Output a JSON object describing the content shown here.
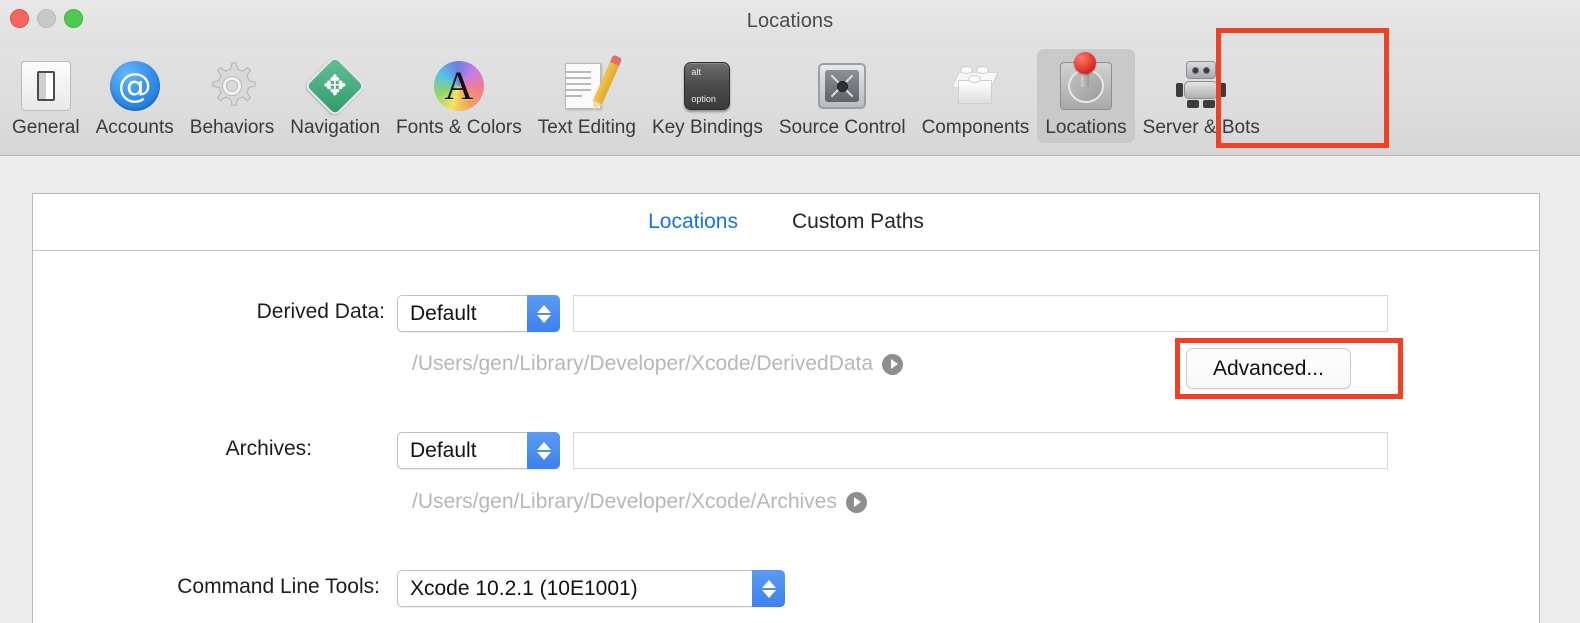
{
  "window": {
    "title": "Locations",
    "traffic_lights": [
      "close-button",
      "minimize-button",
      "zoom-button"
    ]
  },
  "toolbar": {
    "items": [
      {
        "label": "General",
        "icon": "light-switch-icon",
        "selected": false
      },
      {
        "label": "Accounts",
        "icon": "at-sign-icon",
        "selected": false
      },
      {
        "label": "Behaviors",
        "icon": "gear-icon",
        "selected": false
      },
      {
        "label": "Navigation",
        "icon": "four-way-arrow-icon",
        "selected": false
      },
      {
        "label": "Fonts & Colors",
        "icon": "colored-letter-a-icon",
        "selected": false
      },
      {
        "label": "Text Editing",
        "icon": "document-pencil-icon",
        "selected": false
      },
      {
        "label": "Key Bindings",
        "icon": "keyboard-key-icon",
        "selected": false,
        "keycap_top": "alt",
        "keycap_bottom": "option"
      },
      {
        "label": "Source Control",
        "icon": "safe-vault-icon",
        "selected": false
      },
      {
        "label": "Components",
        "icon": "brick-icon",
        "selected": false
      },
      {
        "label": "Locations",
        "icon": "hard-drive-pin-icon",
        "selected": true
      },
      {
        "label": "Server & Bots",
        "icon": "robot-icon",
        "selected": false
      }
    ]
  },
  "tabs": [
    {
      "label": "Locations",
      "active": true
    },
    {
      "label": "Custom Paths",
      "active": false
    }
  ],
  "form": {
    "derived_data": {
      "label": "Derived Data:",
      "popup_value": "Default",
      "text_value": "",
      "path": "/Users/gen/Library/Developer/Xcode/DerivedData",
      "reveal_icon": "reveal-arrow-icon"
    },
    "advanced_button": {
      "label": "Advanced..."
    },
    "archives": {
      "label": "Archives:",
      "popup_value": "Default",
      "text_value": "",
      "path": "/Users/gen/Library/Developer/Xcode/Archives",
      "reveal_icon": "reveal-arrow-icon"
    },
    "command_line_tools": {
      "label": "Command Line Tools:",
      "popup_value": "Xcode 10.2.1 (10E1001)"
    }
  },
  "annotations": [
    {
      "name": "locations-toolbar-highlight",
      "color": "#ef4123"
    },
    {
      "name": "advanced-button-highlight",
      "color": "#ef4123"
    }
  ],
  "colors": {
    "accent_blue": "#1572ec",
    "stepper_blue": "#3d82ec",
    "annotation_red": "#ef4123",
    "window_bg": "#ececec",
    "path_text": "#b7b7b7"
  }
}
